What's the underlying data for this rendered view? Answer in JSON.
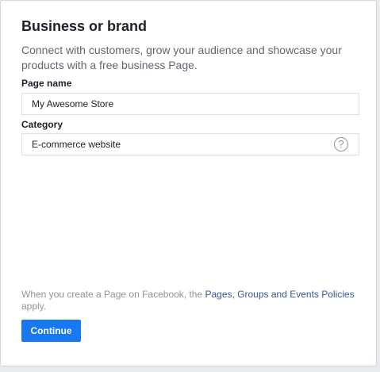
{
  "card": {
    "title": "Business or brand",
    "description": "Connect with customers, grow your audience and showcase your products with a free business Page."
  },
  "fields": {
    "page_name": {
      "label": "Page name",
      "value": "My Awesome Store"
    },
    "category": {
      "label": "Category",
      "value": "E-commerce website",
      "help_icon": "question-mark-icon"
    }
  },
  "policy": {
    "prefix": "When you create a Page on Facebook, the ",
    "link_text": "Pages, Groups and Events Policies",
    "suffix": " apply."
  },
  "actions": {
    "continue_label": "Continue"
  },
  "colors": {
    "accent": "#1877f2",
    "link": "#365899",
    "muted_text": "#90949c",
    "body_text": "#606770",
    "heading_text": "#1d2129"
  }
}
